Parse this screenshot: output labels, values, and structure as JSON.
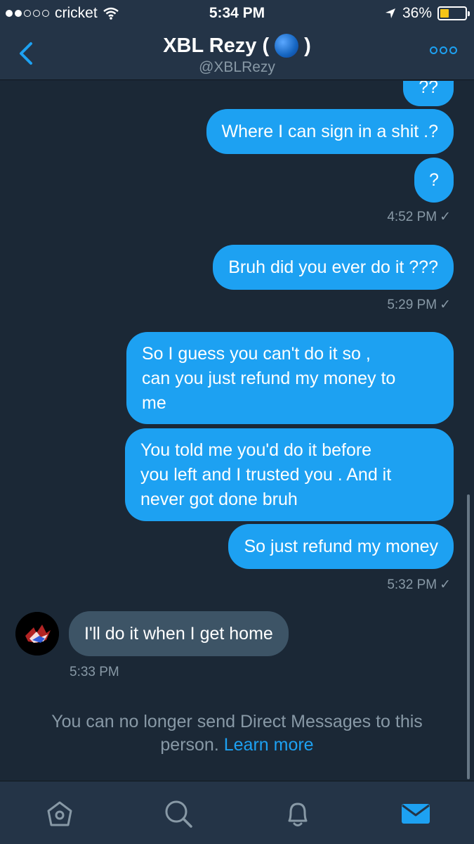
{
  "status_bar": {
    "carrier": "cricket",
    "time": "5:34 PM",
    "battery": "36%",
    "battery_level": 0.36
  },
  "header": {
    "name_prefix": "XBL Rezy (",
    "name_suffix": ")",
    "handle": "@XBLRezy"
  },
  "messages": [
    {
      "text": "??"
    },
    {
      "text": "Where I can sign in a shit .?"
    },
    {
      "text": "?"
    },
    {
      "text": "Bruh did you ever do it ???"
    },
    {
      "text": "So I guess you can't do it so ,\ncan you just refund my money to\nme"
    },
    {
      "text": "You told me you'd do it before\nyou left and I trusted you . And it\nnever got done bruh"
    },
    {
      "text": "So just refund my money"
    },
    {
      "text": "I'll do it when I get home"
    }
  ],
  "timestamps": [
    "4:52 PM",
    "5:29 PM",
    "5:32 PM",
    "5:33 PM"
  ],
  "check_mark": "✓",
  "notice": {
    "text": "You can no longer send Direct Messages to this person.",
    "link": "Learn more"
  },
  "tabs": [
    "home-icon",
    "search-icon",
    "notifications-icon",
    "messages-icon"
  ],
  "colors": {
    "background": "#1b2836",
    "bar": "#243447",
    "accent": "#1da1f2",
    "incoming_bubble": "#3d5466",
    "muted": "#8899a6"
  }
}
